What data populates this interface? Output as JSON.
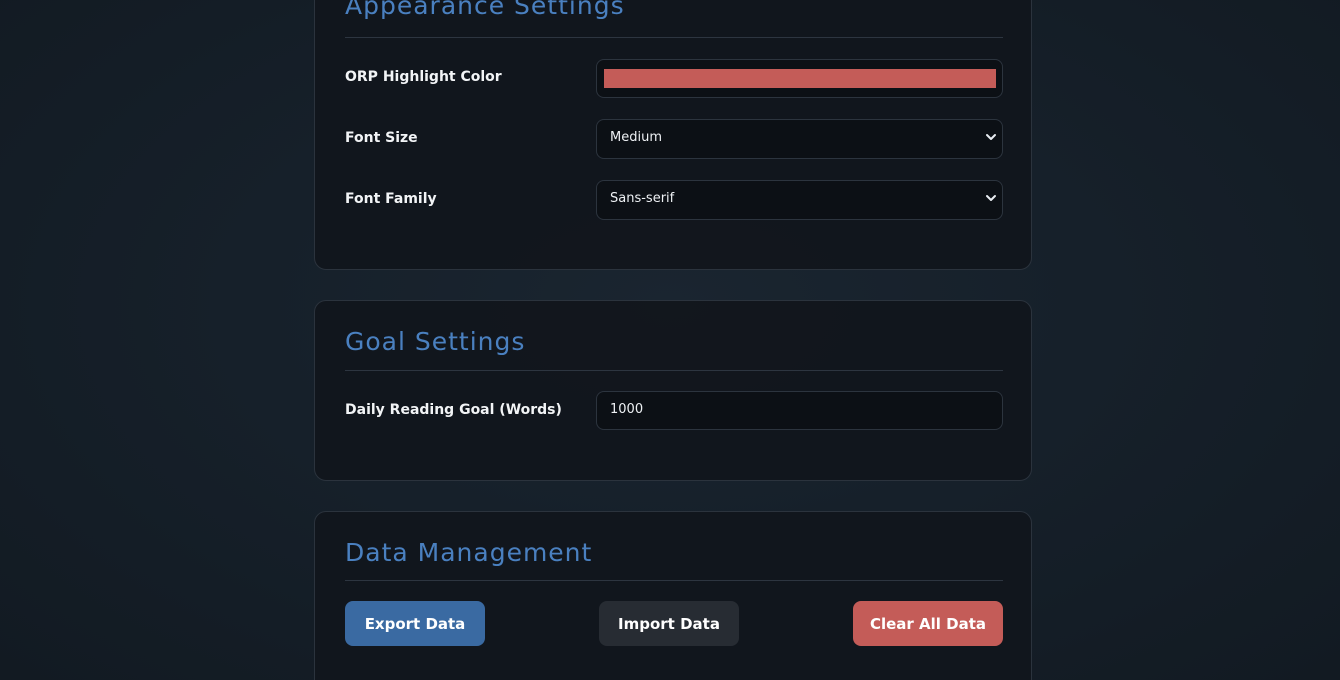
{
  "colors": {
    "accent": "#4a80c0",
    "orp_highlight": "#c45c58",
    "export_button": "#3a6aa2",
    "import_button": "#272c33",
    "clear_button": "#c45c58"
  },
  "appearance": {
    "title": "Appearance Settings",
    "orp_label": "ORP Highlight Color",
    "orp_color": "#c45c58",
    "font_size_label": "Font Size",
    "font_size_value": "Medium",
    "font_family_label": "Font Family",
    "font_family_value": "Sans-serif"
  },
  "goal": {
    "title": "Goal Settings",
    "daily_goal_label": "Daily Reading Goal (Words)",
    "daily_goal_value": "1000"
  },
  "data_management": {
    "title": "Data Management",
    "export_label": "Export Data",
    "import_label": "Import Data",
    "clear_label": "Clear All Data"
  }
}
